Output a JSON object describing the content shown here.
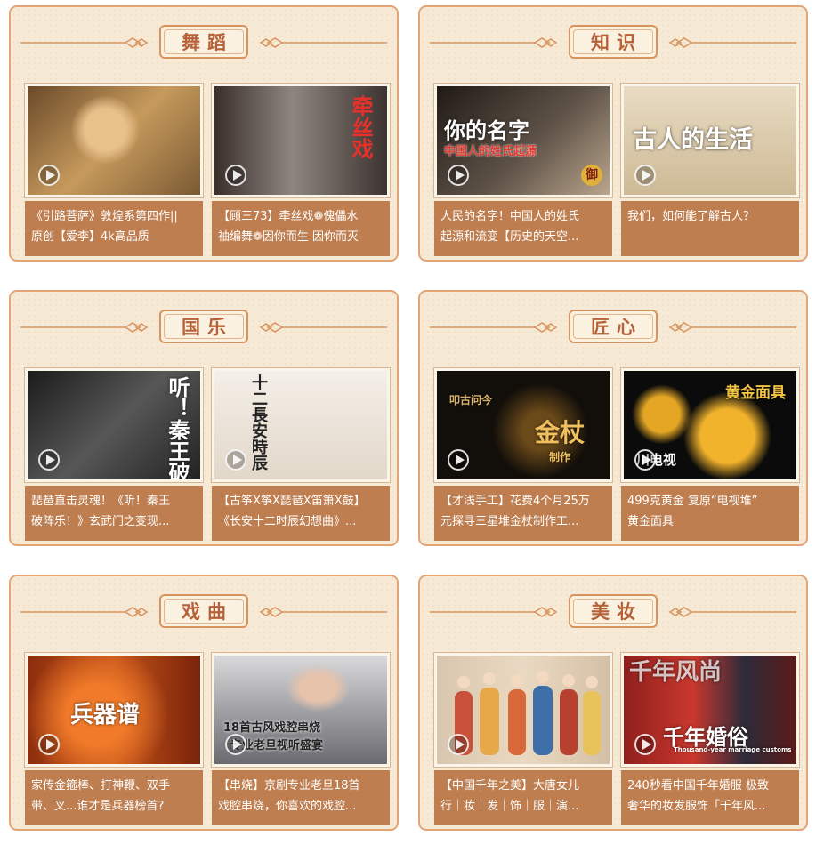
{
  "colors": {
    "panel_bg": "#f6ead6",
    "panel_border": "#e1a577",
    "caption_bg": "#bf7e50",
    "title_text": "#b5623a"
  },
  "sections": [
    {
      "title": "舞蹈",
      "cards": [
        {
          "thumb_text": "",
          "caption_line1": "《引路菩萨》敦煌系第四作||",
          "caption_line2": "原创【爱李】4k高品质"
        },
        {
          "thumb_text": "牵丝戏",
          "caption_line1": "【頋三73】牵丝戏❁傀儡水",
          "caption_line2": "袖编舞❁因你而生 因你而灭"
        }
      ]
    },
    {
      "title": "知识",
      "cards": [
        {
          "thumb_text": "你的名字",
          "thumb_sub": "中国人的姓氏起源",
          "thumb_badge": "御",
          "caption_line1": "人民的名字！中国人的姓氏",
          "caption_line2": "起源和流变【历史的天空..."
        },
        {
          "thumb_text": "古人的生活",
          "caption_line1": "我们，如何能了解古人？",
          "caption_line2": ""
        }
      ]
    },
    {
      "title": "国乐",
      "cards": [
        {
          "thumb_text": "听！秦王破阵乐！",
          "caption_line1": "琵琶直击灵魂！《听！秦王",
          "caption_line2": "破阵乐！》玄武门之变现..."
        },
        {
          "thumb_text": "十二長安時辰",
          "caption_line1": "【古筝X筝X琵琶X笛箫X鼓】",
          "caption_line2": "《长安十二时辰幻想曲》..."
        }
      ]
    },
    {
      "title": "匠心",
      "cards": [
        {
          "thumb_text": "金杖",
          "thumb_sub": "叩古问今",
          "thumb_badge": "制作",
          "caption_line1": "【才浅手工】花费4个月25万",
          "caption_line2": "元探寻三星堆金杖制作工..."
        },
        {
          "thumb_text": "黄金面具",
          "thumb_sub": "川电视",
          "caption_line1": "499克黄金 复原“电视堆”",
          "caption_line2": "黄金面具"
        }
      ]
    },
    {
      "title": "戏曲",
      "cards": [
        {
          "thumb_text": "兵器谱",
          "caption_line1": "家传金箍棒、打神鞭、双手",
          "caption_line2": "带、叉...谁才是兵器榜首?"
        },
        {
          "thumb_text": "18首古风戏腔串烧",
          "thumb_sub": "专业老旦视听盛宴",
          "caption_line1": "【串烧】京剧专业老旦18首",
          "caption_line2": "戏腔串烧，你喜欢的戏腔..."
        }
      ]
    },
    {
      "title": "美妆",
      "cards": [
        {
          "thumb_text": "",
          "caption_line1": "【中国千年之美】大唐女儿",
          "caption_line2": "行｜妆｜发｜饰｜服｜演..."
        },
        {
          "thumb_text": "千年婚俗",
          "thumb_sub": "Thousand-year marriage customs",
          "thumb_top": "千年风尚",
          "caption_line1": "240秒看中国千年婚服 极致",
          "caption_line2": "奢华的妆发服饰「千年风..."
        }
      ]
    }
  ]
}
